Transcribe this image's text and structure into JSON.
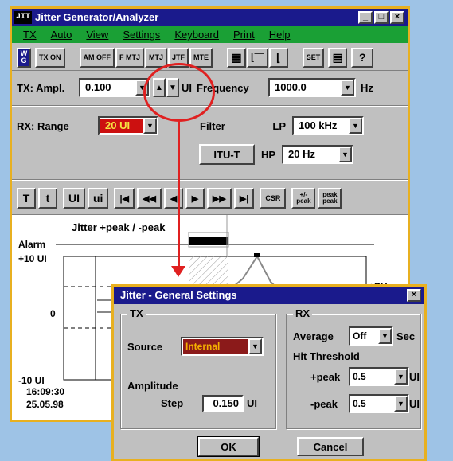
{
  "main_window": {
    "app_icon": "JIT",
    "title": "Jitter Generator/Analyzer",
    "window_controls": [
      "_",
      "□",
      "×"
    ],
    "menu": [
      "TX",
      "Auto",
      "View",
      "Settings",
      "Keyboard",
      "Print",
      "Help"
    ]
  },
  "toolbar": {
    "buttons": [
      {
        "name": "wg-logo-button",
        "label": "W G"
      },
      {
        "name": "tx-on-button",
        "label": "TX ON"
      },
      {
        "name": "am-off-button",
        "label": "AM OFF"
      },
      {
        "name": "f-mtj-button",
        "label": "F MTJ"
      },
      {
        "name": "mtj-button",
        "label": "MTJ"
      },
      {
        "name": "jtf-button",
        "label": "JTF"
      },
      {
        "name": "mte-button",
        "label": "MTE"
      },
      {
        "name": "table-view-icon",
        "label": "▦"
      },
      {
        "name": "graph-view-icon",
        "label": "⌊⎺"
      },
      {
        "name": "axis-view-icon",
        "label": "⌊"
      },
      {
        "name": "set-button",
        "label": "SET"
      },
      {
        "name": "calculator-icon",
        "label": "▤"
      },
      {
        "name": "help-icon",
        "label": "?"
      }
    ]
  },
  "tx": {
    "ampl_label": "TX: Ampl.",
    "ampl_value": "0.100",
    "ampl_unit": "UI",
    "freq_label": "Frequency",
    "freq_value": "1000.0",
    "freq_unit": "Hz",
    "step_up": "▲",
    "step_down": "▼"
  },
  "rx": {
    "range_label": "RX: Range",
    "range_value": "20 UI",
    "filter_label": "Filter",
    "lp_label": "LP",
    "lp_value": "100 kHz",
    "hp_label": "HP",
    "hp_value": "20 Hz",
    "itut_label": "ITU-T"
  },
  "nav_buttons": [
    "T",
    "t",
    "UI",
    "ui",
    "|◀",
    "◀◀",
    "◀",
    "▶",
    "▶▶",
    "▶|",
    "CSR",
    "+/- peak",
    "peak peak"
  ],
  "chart": {
    "title": "Jitter  +peak / -peak",
    "alarm_label": "Alarm",
    "y_top": "+10 UI",
    "y_mid": "0",
    "y_bot": "-10 UI",
    "ph_label": "+PH",
    "time": "16:09:30",
    "date": "25.05.98"
  },
  "dialog": {
    "title": "Jitter - General Settings",
    "close": "×",
    "tx_group": "TX",
    "source_label": "Source",
    "source_value": "Internal",
    "amplitude_label": "Amplitude",
    "step_label": "Step",
    "step_value": "0.150",
    "step_unit": "UI",
    "rx_group": "RX",
    "average_label": "Average",
    "average_value": "Off",
    "average_unit": "Sec",
    "hit_label": "Hit Threshold",
    "pos_peak_label": "+peak",
    "pos_peak_value": "0.5",
    "neg_peak_label": "-peak",
    "neg_peak_value": "0.5",
    "unit_ui": "UI",
    "ok": "OK",
    "cancel": "Cancel"
  },
  "colors": {
    "title_bar": "#1a1a8c",
    "menu_bar": "#1aa035",
    "frame": "#e8b020",
    "callout": "#e02020",
    "range_highlight": "#cc1010",
    "source_highlight": "#8b1a1a"
  }
}
